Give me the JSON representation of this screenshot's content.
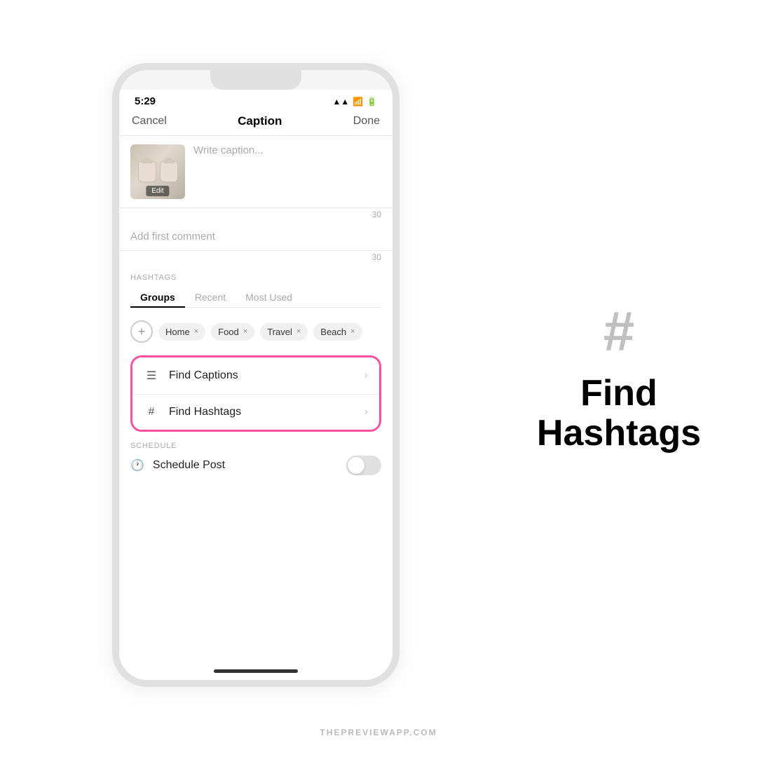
{
  "page": {
    "background": "#ffffff",
    "footer": "THEPREVIEWAPP.COM"
  },
  "phone": {
    "status_bar": {
      "time": "5:29",
      "signal": "▲▲",
      "wifi": "wifi",
      "battery": "battery"
    },
    "nav": {
      "cancel": "Cancel",
      "title": "Caption",
      "done": "Done"
    },
    "caption": {
      "placeholder": "Write caption...",
      "edit_label": "Edit",
      "char_count": "30"
    },
    "comment": {
      "placeholder": "Add first comment",
      "char_count": "30"
    },
    "hashtags": {
      "section_label": "HASHTAGS",
      "tabs": [
        "Groups",
        "Recent",
        "Most Used"
      ],
      "active_tab": 0,
      "groups": [
        "Home",
        "Food",
        "Travel",
        "Beach"
      ]
    },
    "find_options": [
      {
        "id": "find-captions",
        "icon": "lines",
        "label": "Find Captions"
      },
      {
        "id": "find-hashtags",
        "icon": "hash",
        "label": "Find Hashtags"
      }
    ],
    "schedule": {
      "section_label": "SCHEDULE",
      "label": "Schedule Post",
      "toggle_on": false
    }
  },
  "right_panel": {
    "symbol": "#",
    "title_line1": "Find",
    "title_line2": "Hashtags"
  }
}
